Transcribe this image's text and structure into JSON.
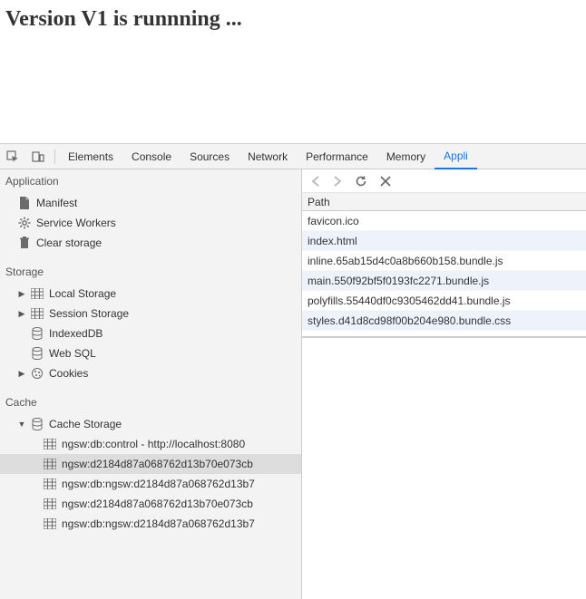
{
  "header": {
    "title": "Version V1 is runnning ..."
  },
  "tabs": {
    "elements": "Elements",
    "console": "Console",
    "sources": "Sources",
    "network": "Network",
    "performance": "Performance",
    "memory": "Memory",
    "application": "Appli"
  },
  "sidebar": {
    "groups": {
      "application": {
        "title": "Application",
        "items": [
          {
            "label": "Manifest"
          },
          {
            "label": "Service Workers"
          },
          {
            "label": "Clear storage"
          }
        ]
      },
      "storage": {
        "title": "Storage",
        "items": [
          {
            "label": "Local Storage"
          },
          {
            "label": "Session Storage"
          },
          {
            "label": "IndexedDB"
          },
          {
            "label": "Web SQL"
          },
          {
            "label": "Cookies"
          }
        ]
      },
      "cache": {
        "title": "Cache",
        "cache_storage_label": "Cache Storage",
        "entries": [
          "ngsw:db:control - http://localhost:8080",
          "ngsw:d2184d87a068762d13b70e073cb",
          "ngsw:db:ngsw:d2184d87a068762d13b7",
          "ngsw:d2184d87a068762d13b70e073cb",
          "ngsw:db:ngsw:d2184d87a068762d13b7"
        ]
      }
    }
  },
  "table": {
    "header": "Path",
    "rows": [
      "favicon.ico",
      "index.html",
      "inline.65ab15d4c0a8b660b158.bundle.js",
      "main.550f92bf5f0193fc2271.bundle.js",
      "polyfills.55440df0c9305462dd41.bundle.js",
      "styles.d41d8cd98f00b204e980.bundle.css"
    ]
  }
}
